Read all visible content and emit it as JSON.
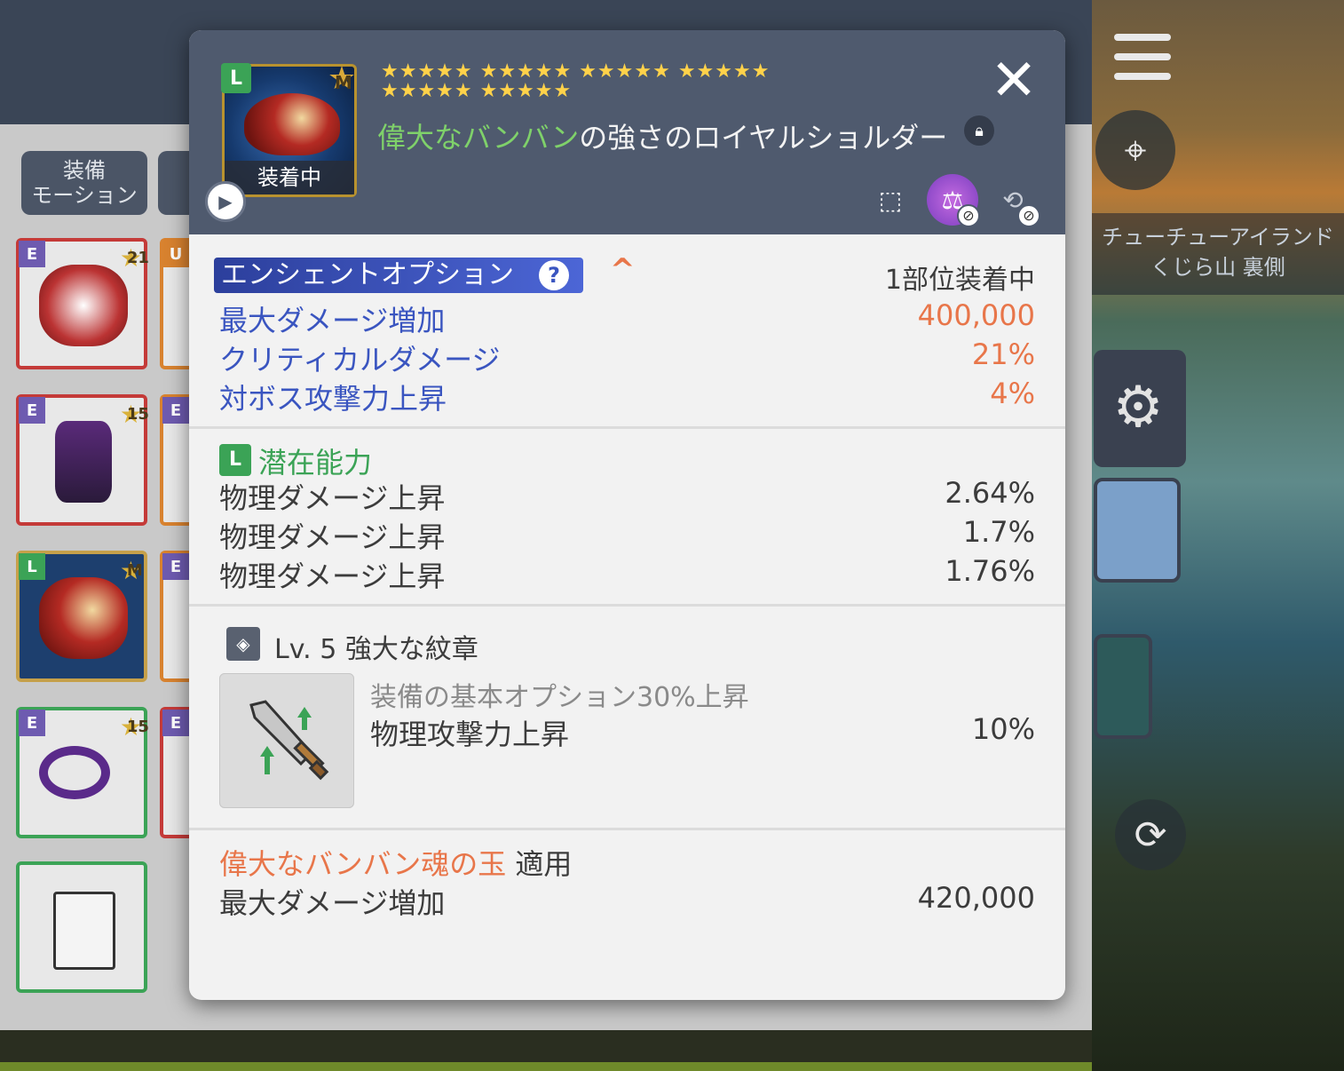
{
  "background": {
    "motion_button": "装備\nモーション",
    "map_label_line1": "チューチューアイランド",
    "map_label_line2": "くじら山 裏側",
    "slots": [
      {
        "grade": "E",
        "stars": "21",
        "border": "red"
      },
      {
        "grade": "U",
        "stars": "",
        "border": "orange"
      },
      {
        "grade": "E",
        "stars": "15",
        "border": "red"
      },
      {
        "grade": "E",
        "stars": "",
        "border": "orange"
      },
      {
        "grade": "L",
        "stars": "M",
        "border": "red"
      },
      {
        "grade": "E",
        "stars": "",
        "border": "orange"
      },
      {
        "grade": "E",
        "stars": "15",
        "border": "green"
      },
      {
        "grade": "E",
        "stars": "",
        "border": "red"
      }
    ]
  },
  "item": {
    "grade": "L",
    "star_badge": "M",
    "equipped_label": "装着中",
    "star_rows": [
      "★★★★★ ★★★★★ ★★★★★ ★★★★★",
      "★★★★★ ★★★★★"
    ],
    "name_highlight": "偉大なバンバン",
    "name_rest": "の強さのロイヤルショルダー",
    "close_label": "✕"
  },
  "ancient": {
    "title": "エンシェントオプション",
    "help": "?",
    "equip_status": "1部位装着中",
    "options": [
      {
        "label": "最大ダメージ増加",
        "value": "400,000"
      },
      {
        "label": "クリティカルダメージ",
        "value": "21%"
      },
      {
        "label": "対ボス攻撃力上昇",
        "value": "4%"
      }
    ]
  },
  "potential": {
    "grade": "L",
    "title": "潜在能力",
    "options": [
      {
        "label": "物理ダメージ上昇",
        "value": "2.64%"
      },
      {
        "label": "物理ダメージ上昇",
        "value": "1.7%"
      },
      {
        "label": "物理ダメージ上昇",
        "value": "1.76%"
      }
    ]
  },
  "emblem": {
    "title": "Lv. 5 強大な紋章",
    "description": "装備の基本オプション30%上昇",
    "stat_label": "物理攻撃力上昇",
    "stat_value": "10%"
  },
  "soul": {
    "name": "偉大なバンバン魂の玉",
    "applied": "適用",
    "stat_label": "最大ダメージ増加",
    "stat_value": "420,000"
  },
  "colors": {
    "header_bg": "#4f5a6e",
    "ancient_blue": "#3a55c0",
    "value_orange": "#e8764a",
    "legendary_green": "#3ba356",
    "star_yellow": "#ffd24a"
  }
}
